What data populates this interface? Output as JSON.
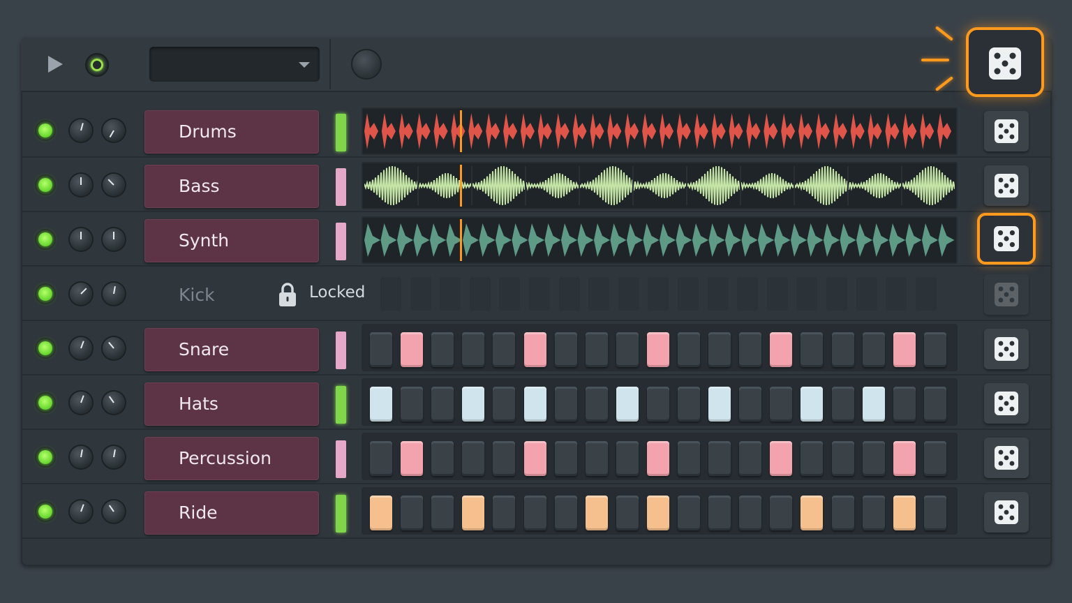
{
  "colors": {
    "accent": "#ff9a1e",
    "led_on": "#7be23b",
    "channel_button": "#5c3446",
    "drums_wave": "#e0554a",
    "bass_wave": "#c6e6a8",
    "synth_wave": "#5e9a86",
    "playhead": "#ff9a1e"
  },
  "toolbar": {
    "play_icon": "play-icon",
    "record_icon": "record-icon",
    "pattern_value": "",
    "randomize_all_icon": "dice-icon"
  },
  "channels": [
    {
      "name": "Drums",
      "mixer_color": "#7fd64a",
      "display": "waveform",
      "wave_color": "#e0554a",
      "knob_a": "15",
      "knob_b": "-150"
    },
    {
      "name": "Bass",
      "mixer_color": "#e6a8c8",
      "display": "waveform",
      "wave_color": "#c6e6a8",
      "knob_a": "0",
      "knob_b": "-45"
    },
    {
      "name": "Synth",
      "mixer_color": "#e6a8c8",
      "display": "waveform",
      "wave_color": "#5e9a86",
      "knob_a": "0",
      "knob_b": "0",
      "dice_highlighted": true
    },
    {
      "name": "Kick",
      "locked": true,
      "locked_label": "Locked",
      "display": "steps",
      "knob_a": "45",
      "knob_b": "10"
    },
    {
      "name": "Snare",
      "mixer_color": "#e6a8c8",
      "display": "steps",
      "step_color": "#f2a3ad",
      "steps": [
        0,
        1,
        0,
        0,
        0,
        1,
        0,
        0,
        0,
        1,
        0,
        0,
        0,
        1,
        0,
        0,
        0,
        1,
        0
      ],
      "knob_a": "20",
      "knob_b": "-40"
    },
    {
      "name": "Hats",
      "mixer_color": "#7fd64a",
      "display": "steps",
      "step_color": "#cfe4ec",
      "steps": [
        1,
        0,
        0,
        1,
        0,
        1,
        0,
        0,
        1,
        0,
        0,
        1,
        0,
        0,
        1,
        0,
        1,
        0,
        0
      ],
      "knob_a": "20",
      "knob_b": "-35"
    },
    {
      "name": "Percussion",
      "mixer_color": "#e6a8c8",
      "display": "steps",
      "step_color": "#f2a3ad",
      "steps": [
        0,
        1,
        0,
        0,
        0,
        1,
        0,
        0,
        0,
        1,
        0,
        0,
        0,
        1,
        0,
        0,
        0,
        1,
        0
      ],
      "knob_a": "10",
      "knob_b": "10"
    },
    {
      "name": "Ride",
      "mixer_color": "#7fd64a",
      "display": "steps",
      "step_color": "#f5c08e",
      "steps": [
        1,
        0,
        0,
        1,
        0,
        0,
        0,
        1,
        0,
        1,
        0,
        0,
        0,
        0,
        1,
        0,
        0,
        1,
        0
      ],
      "knob_a": "20",
      "knob_b": "-35"
    }
  ],
  "playhead_fraction": 0.163
}
